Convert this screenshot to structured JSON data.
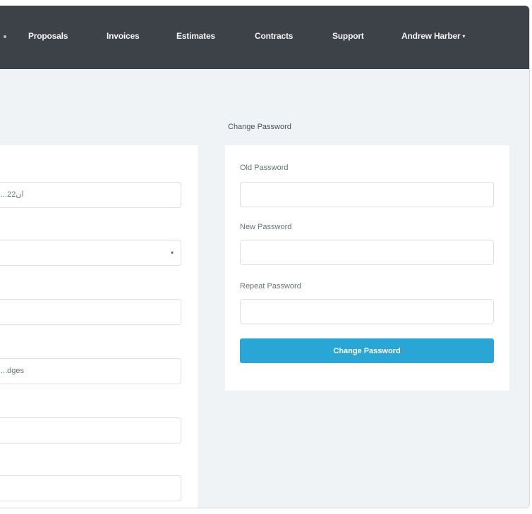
{
  "nav": {
    "items": [
      "Proposals",
      "Invoices",
      "Estimates",
      "Contracts",
      "Support"
    ],
    "user": "Andrew Harber",
    "user_caret": "▾"
  },
  "profile_form": {
    "field_values": [
      "...ان22",
      "",
      "",
      "...dges",
      "",
      ""
    ],
    "select_arrow": "▾"
  },
  "change_password": {
    "title": "Change Password",
    "old_label": "Old Password",
    "new_label": "New Password",
    "repeat_label": "Repeat Password",
    "button_label": "Change Password"
  },
  "colors": {
    "navbar": "#3d4148",
    "background": "#f0f3f6",
    "button": "#2aa6d6"
  }
}
